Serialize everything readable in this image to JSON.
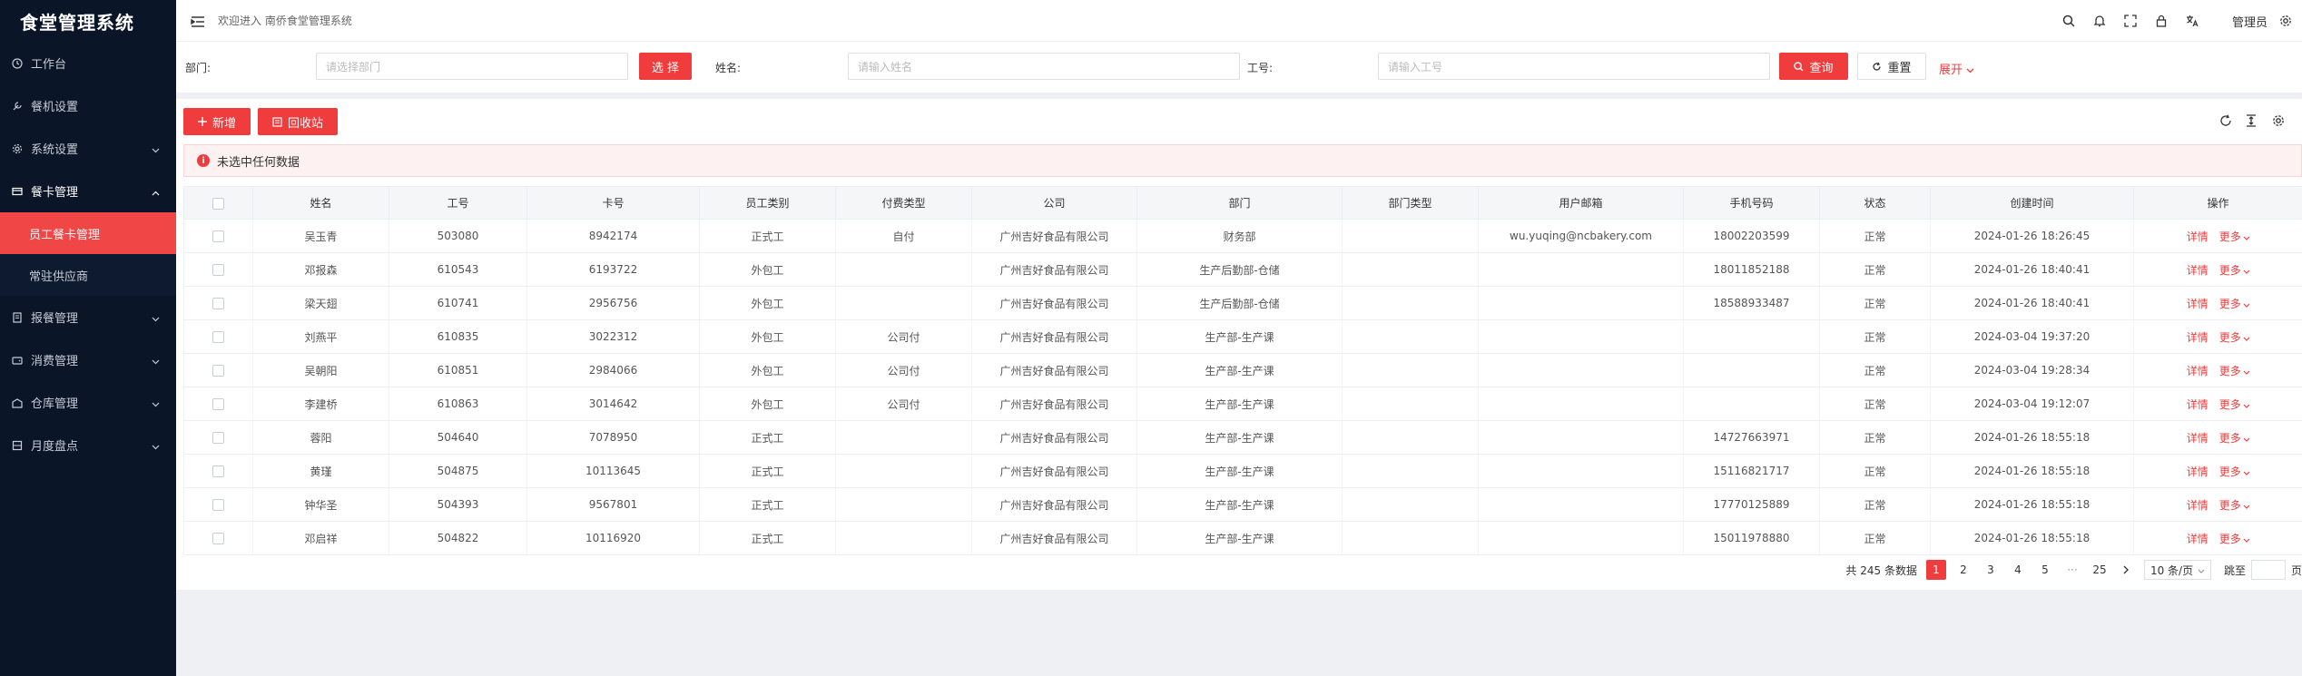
{
  "app": {
    "title": "食堂管理系统"
  },
  "sidebar": {
    "items": [
      {
        "label": "工作台",
        "icon": "clock-icon"
      },
      {
        "label": "餐机设置",
        "icon": "wrench-icon"
      },
      {
        "label": "系统设置",
        "icon": "gear-icon"
      },
      {
        "label": "餐卡管理",
        "icon": "card-icon"
      },
      {
        "label": "报餐管理",
        "icon": "ledger-icon"
      },
      {
        "label": "消费管理",
        "icon": "wallet-icon"
      },
      {
        "label": "仓库管理",
        "icon": "warehouse-icon"
      },
      {
        "label": "月度盘点",
        "icon": "stack-icon"
      }
    ],
    "sub_items": [
      {
        "label": "员工餐卡管理"
      },
      {
        "label": "常驻供应商"
      }
    ]
  },
  "header": {
    "welcome": "欢迎进入 南侨食堂管理系统",
    "user": "管理员"
  },
  "search": {
    "dept_label": "部门:",
    "dept_placeholder": "请选择部门",
    "select_btn": "选 择",
    "name_label": "姓名:",
    "name_placeholder": "请输入姓名",
    "id_label": "工号:",
    "id_placeholder": "请输入工号",
    "query_btn": "查询",
    "reset_btn": "重置",
    "expand": "展开"
  },
  "toolbar": {
    "add_btn": "新增",
    "recycle_btn": "回收站"
  },
  "alert": {
    "text": "未选中任何数据"
  },
  "table": {
    "columns": [
      "姓名",
      "工号",
      "卡号",
      "员工类别",
      "付费类型",
      "公司",
      "部门",
      "部门类型",
      "用户邮箱",
      "手机号码",
      "状态",
      "创建时间",
      "操作"
    ],
    "detail_label": "详情",
    "more_label": "更多",
    "rows": [
      {
        "name": "吴玉青",
        "id": "503080",
        "card": "8942174",
        "type": "正式工",
        "pay": "自付",
        "company": "广州吉好食品有限公司",
        "dept": "财务部",
        "dept_type": "",
        "email": "wu.yuqing@ncbakery.com",
        "phone": "18002203599",
        "status": "正常",
        "created": "2024-01-26 18:26:45"
      },
      {
        "name": "邓报森",
        "id": "610543",
        "card": "6193722",
        "type": "外包工",
        "pay": "",
        "company": "广州吉好食品有限公司",
        "dept": "生产后勤部-仓储",
        "dept_type": "",
        "email": "",
        "phone": "18011852188",
        "status": "正常",
        "created": "2024-01-26 18:40:41"
      },
      {
        "name": "梁天翅",
        "id": "610741",
        "card": "2956756",
        "type": "外包工",
        "pay": "",
        "company": "广州吉好食品有限公司",
        "dept": "生产后勤部-仓储",
        "dept_type": "",
        "email": "",
        "phone": "18588933487",
        "status": "正常",
        "created": "2024-01-26 18:40:41"
      },
      {
        "name": "刘燕平",
        "id": "610835",
        "card": "3022312",
        "type": "外包工",
        "pay": "公司付",
        "company": "广州吉好食品有限公司",
        "dept": "生产部-生产课",
        "dept_type": "",
        "email": "",
        "phone": "",
        "status": "正常",
        "created": "2024-03-04 19:37:20"
      },
      {
        "name": "吴朝阳",
        "id": "610851",
        "card": "2984066",
        "type": "外包工",
        "pay": "公司付",
        "company": "广州吉好食品有限公司",
        "dept": "生产部-生产课",
        "dept_type": "",
        "email": "",
        "phone": "",
        "status": "正常",
        "created": "2024-03-04 19:28:34"
      },
      {
        "name": "李建桥",
        "id": "610863",
        "card": "3014642",
        "type": "外包工",
        "pay": "公司付",
        "company": "广州吉好食品有限公司",
        "dept": "生产部-生产课",
        "dept_type": "",
        "email": "",
        "phone": "",
        "status": "正常",
        "created": "2024-03-04 19:12:07"
      },
      {
        "name": "蓉阳",
        "id": "504640",
        "card": "7078950",
        "type": "正式工",
        "pay": "",
        "company": "广州吉好食品有限公司",
        "dept": "生产部-生产课",
        "dept_type": "",
        "email": "",
        "phone": "14727663971",
        "status": "正常",
        "created": "2024-01-26 18:55:18"
      },
      {
        "name": "黄瑾",
        "id": "504875",
        "card": "10113645",
        "type": "正式工",
        "pay": "",
        "company": "广州吉好食品有限公司",
        "dept": "生产部-生产课",
        "dept_type": "",
        "email": "",
        "phone": "15116821717",
        "status": "正常",
        "created": "2024-01-26 18:55:18"
      },
      {
        "name": "钟华圣",
        "id": "504393",
        "card": "9567801",
        "type": "正式工",
        "pay": "",
        "company": "广州吉好食品有限公司",
        "dept": "生产部-生产课",
        "dept_type": "",
        "email": "",
        "phone": "17770125889",
        "status": "正常",
        "created": "2024-01-26 18:55:18"
      },
      {
        "name": "邓启祥",
        "id": "504822",
        "card": "10116920",
        "type": "正式工",
        "pay": "",
        "company": "广州吉好食品有限公司",
        "dept": "生产部-生产课",
        "dept_type": "",
        "email": "",
        "phone": "15011978880",
        "status": "正常",
        "created": "2024-01-26 18:55:18"
      }
    ]
  },
  "pagination": {
    "total_text": "共 245 条数据",
    "pages": [
      "1",
      "2",
      "3",
      "4",
      "5"
    ],
    "ellipsis": "···",
    "last_page": "25",
    "page_size": "10 条/页",
    "jump_label": "跳至",
    "page_suffix": "页"
  },
  "colors": {
    "accent": "#f03c3c",
    "sidebar_bg": "#0b1528"
  }
}
